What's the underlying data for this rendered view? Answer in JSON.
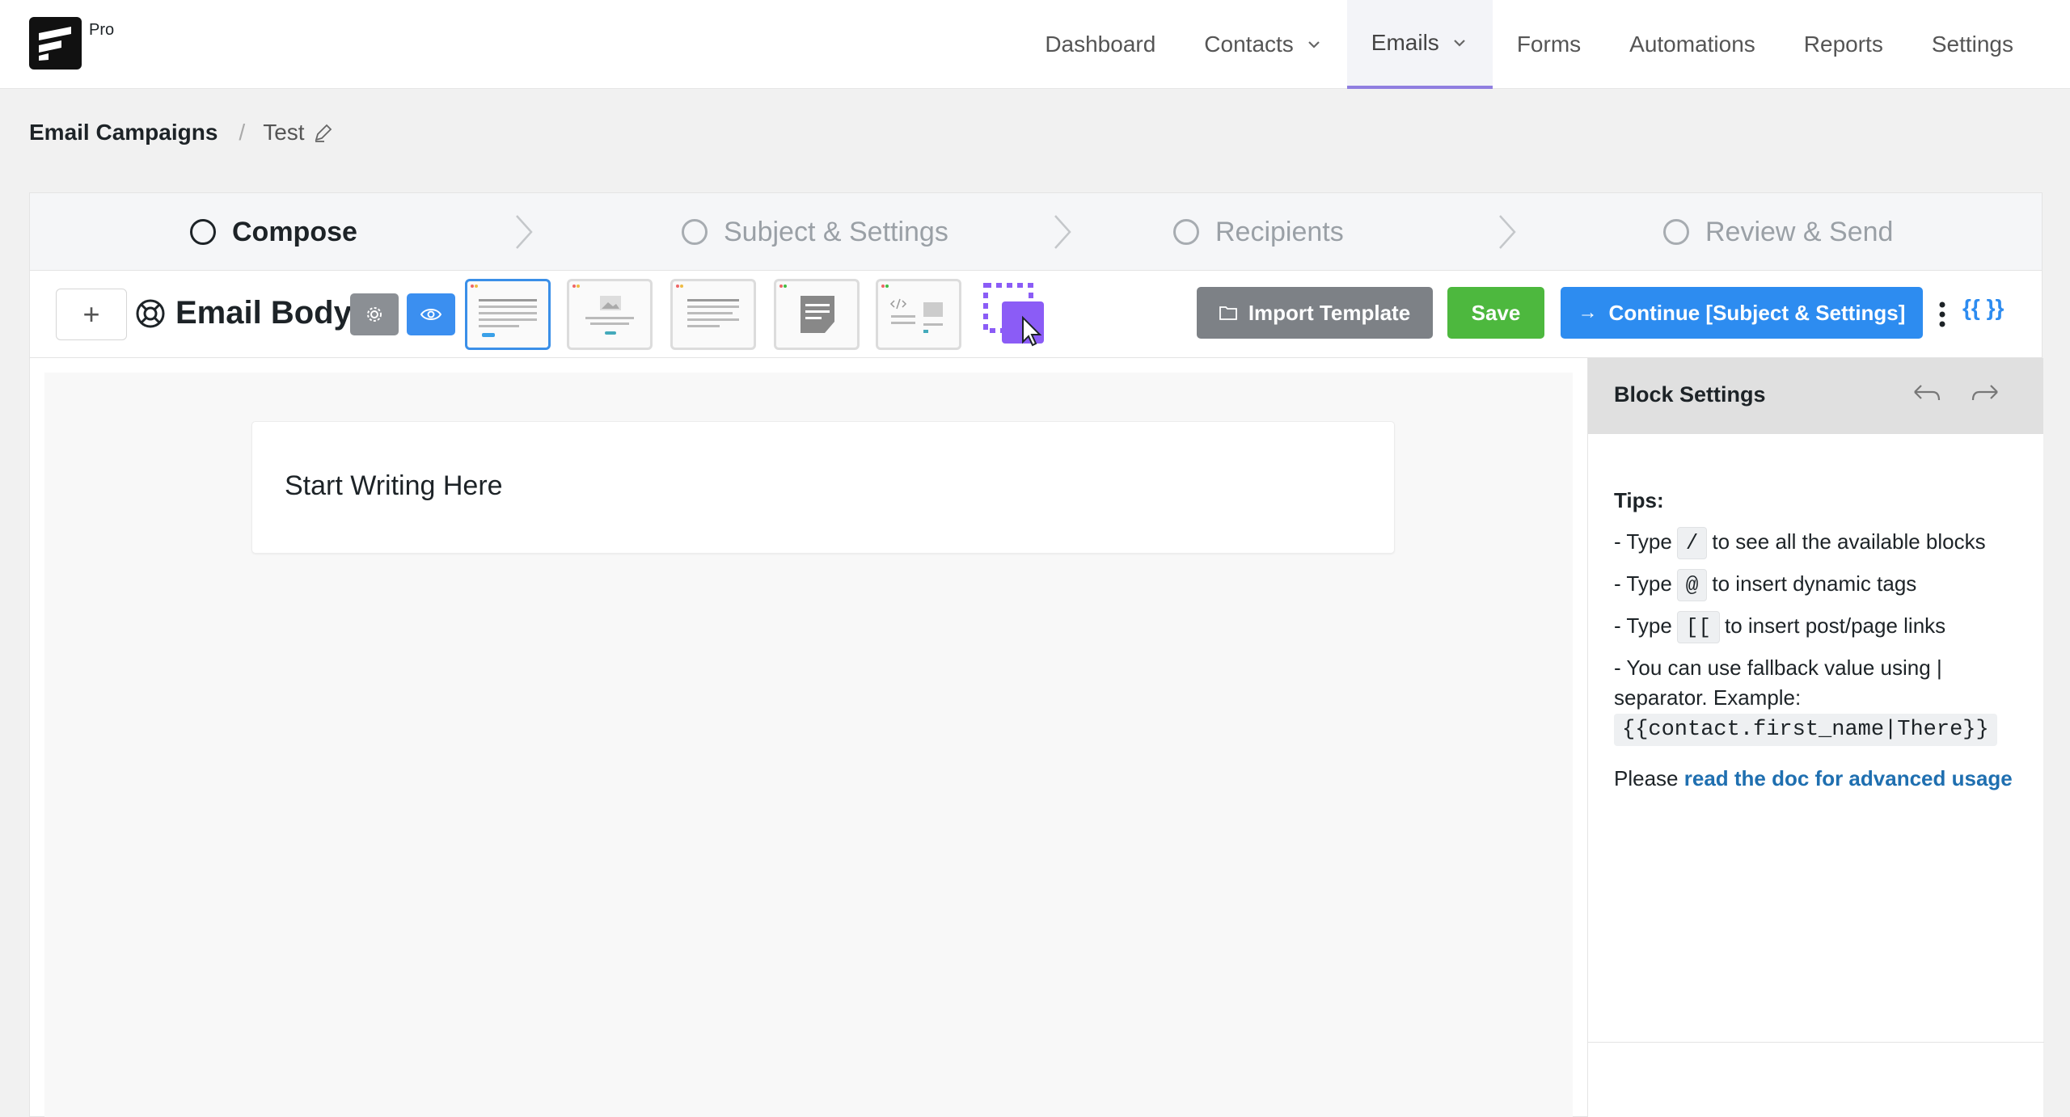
{
  "brand": {
    "badge": "Pro"
  },
  "nav": {
    "items": [
      {
        "label": "Dashboard"
      },
      {
        "label": "Contacts"
      },
      {
        "label": "Emails"
      },
      {
        "label": "Forms"
      },
      {
        "label": "Automations"
      },
      {
        "label": "Reports"
      },
      {
        "label": "Settings"
      }
    ]
  },
  "breadcrumb": {
    "parent": "Email Campaigns",
    "separator": "/",
    "current": "Test"
  },
  "steps": [
    {
      "label": "Compose"
    },
    {
      "label": "Subject & Settings"
    },
    {
      "label": "Recipients"
    },
    {
      "label": "Review & Send"
    }
  ],
  "toolbar": {
    "add_label": "+",
    "title": "Email Body",
    "import_label": "Import Template",
    "save_label": "Save",
    "continue_label": "Continue [Subject & Settings]",
    "tags_label": "{{ }}"
  },
  "editor": {
    "placeholder": "Start Writing Here"
  },
  "block_settings": {
    "title": "Block Settings",
    "tips_title": "Tips:",
    "tip1_pre": "- Type",
    "tip1_key": "/",
    "tip1_post": "to see all the available blocks",
    "tip2_pre": "- Type",
    "tip2_key": "@",
    "tip2_post": "to insert dynamic tags",
    "tip3_pre": "- Type",
    "tip3_key": "[[",
    "tip3_post": "to insert post/page links",
    "tip4_text": "- You can use fallback value using | separator. Example:",
    "tip4_code": "{{contact.first_name|There}}",
    "doc_pre": "Please",
    "doc_link": "read the doc for advanced usage"
  },
  "colors": {
    "accent_purple": "#8f7ee0",
    "primary_blue": "#2d8cf0",
    "save_green": "#4db83e",
    "import_gray": "#7d8186"
  }
}
